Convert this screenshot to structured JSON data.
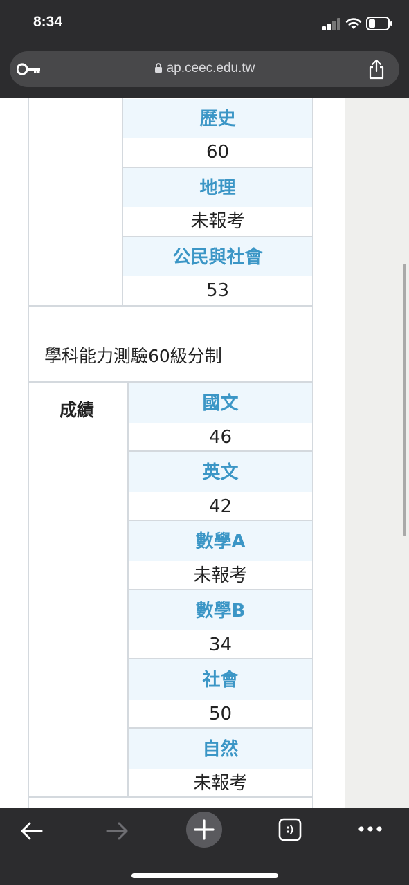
{
  "status": {
    "time": "8:34"
  },
  "browser": {
    "url": "ap.ceec.edu.tw"
  },
  "table1": [
    {
      "subject": "歷史",
      "score": "60"
    },
    {
      "subject": "地理",
      "score": "未報考"
    },
    {
      "subject": "公民與社會",
      "score": "53"
    }
  ],
  "section_title": "學科能力測驗60級分制",
  "score_label": "成績",
  "table2": [
    {
      "subject": "國文",
      "score": "46"
    },
    {
      "subject": "英文",
      "score": "42"
    },
    {
      "subject": "數學A",
      "score": "未報考"
    },
    {
      "subject": "數學B",
      "score": "34"
    },
    {
      "subject": "社會",
      "score": "50"
    },
    {
      "subject": "自然",
      "score": "未報考"
    }
  ],
  "colors": {
    "header_text": "#3b96c6",
    "header_bg": "#eef7fd",
    "border": "#d4d9de",
    "chrome": "#2c2c2e"
  },
  "icons": [
    "key-icon",
    "lock-icon",
    "share-icon",
    "back-arrow-icon",
    "forward-arrow-icon",
    "plus-icon",
    "tabs-icon",
    "more-icon"
  ]
}
